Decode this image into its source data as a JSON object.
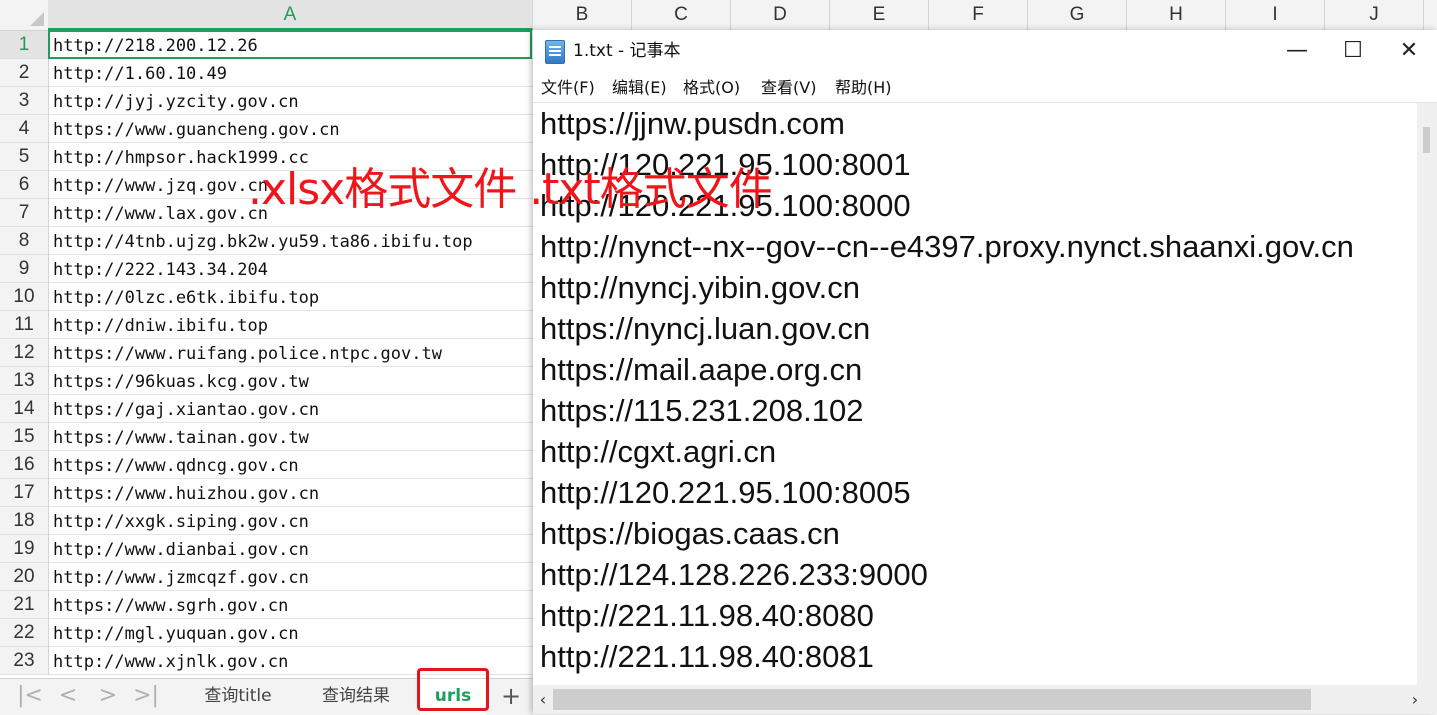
{
  "spreadsheet": {
    "columns": [
      "A",
      "B",
      "C",
      "D",
      "E",
      "F",
      "G",
      "H",
      "I",
      "J"
    ],
    "selected_column": "A",
    "selected_row": 1,
    "rows": [
      {
        "num": "1",
        "url": "http://218.200.12.26"
      },
      {
        "num": "2",
        "url": "http://1.60.10.49"
      },
      {
        "num": "3",
        "url": "http://jyj.yzcity.gov.cn"
      },
      {
        "num": "4",
        "url": "https://www.guancheng.gov.cn"
      },
      {
        "num": "5",
        "url": "http://hmpsor.hack1999.cc"
      },
      {
        "num": "6",
        "url": "http://www.jzq.gov.cn"
      },
      {
        "num": "7",
        "url": "http://www.lax.gov.cn"
      },
      {
        "num": "8",
        "url": "http://4tnb.ujzg.bk2w.yu59.ta86.ibifu.top"
      },
      {
        "num": "9",
        "url": "http://222.143.34.204"
      },
      {
        "num": "10",
        "url": "http://0lzc.e6tk.ibifu.top"
      },
      {
        "num": "11",
        "url": "http://dniw.ibifu.top"
      },
      {
        "num": "12",
        "url": "https://www.ruifang.police.ntpc.gov.tw"
      },
      {
        "num": "13",
        "url": "https://96kuas.kcg.gov.tw"
      },
      {
        "num": "14",
        "url": "https://gaj.xiantao.gov.cn"
      },
      {
        "num": "15",
        "url": "https://www.tainan.gov.tw"
      },
      {
        "num": "16",
        "url": "https://www.qdncg.gov.cn"
      },
      {
        "num": "17",
        "url": "https://www.huizhou.gov.cn"
      },
      {
        "num": "18",
        "url": "http://xxgk.siping.gov.cn"
      },
      {
        "num": "19",
        "url": "http://www.dianbai.gov.cn"
      },
      {
        "num": "20",
        "url": "http://www.jzmcqzf.gov.cn"
      },
      {
        "num": "21",
        "url": "https://www.sgrh.gov.cn"
      },
      {
        "num": "22",
        "url": "http://mgl.yuquan.gov.cn"
      },
      {
        "num": "23",
        "url": "http://www.xjnlk.gov.cn"
      }
    ],
    "sheet_tabs": [
      {
        "label": "查询title",
        "active": false
      },
      {
        "label": "查询结果",
        "active": false
      },
      {
        "label": "urls",
        "active": true
      }
    ],
    "nav_icons": [
      "first-sheet-icon",
      "prev-sheet-icon",
      "next-sheet-icon",
      "last-sheet-icon"
    ],
    "add_sheet_label": "+"
  },
  "notepad": {
    "title": "1.txt - 记事本",
    "window_buttons": {
      "minimize": "—",
      "maximize": "☐",
      "close": "✕"
    },
    "menu": [
      "文件(F)",
      "编辑(E)",
      "格式(O)",
      "查看(V)",
      "帮助(H)"
    ],
    "lines": [
      "https://jjnw.pusdn.com",
      "http://120.221.95.100:8001",
      "http://120.221.95.100:8000",
      "http://nynct--nx--gov--cn--e4397.proxy.nynct.shaanxi.gov.cn",
      "http://nyncj.yibin.gov.cn",
      "https://nyncj.luan.gov.cn",
      "https://mail.aape.org.cn",
      "https://115.231.208.102",
      "http://cgxt.agri.cn",
      "http://120.221.95.100:8005",
      "https://biogas.caas.cn",
      "http://124.128.226.233:9000",
      "http://221.11.98.40:8080",
      "http://221.11.98.40:8081"
    ]
  },
  "annotation": ".xlsx格式文件 .txt格式文件",
  "colors": {
    "accent": "#1e9e5a",
    "annotation": "#f0151a"
  }
}
